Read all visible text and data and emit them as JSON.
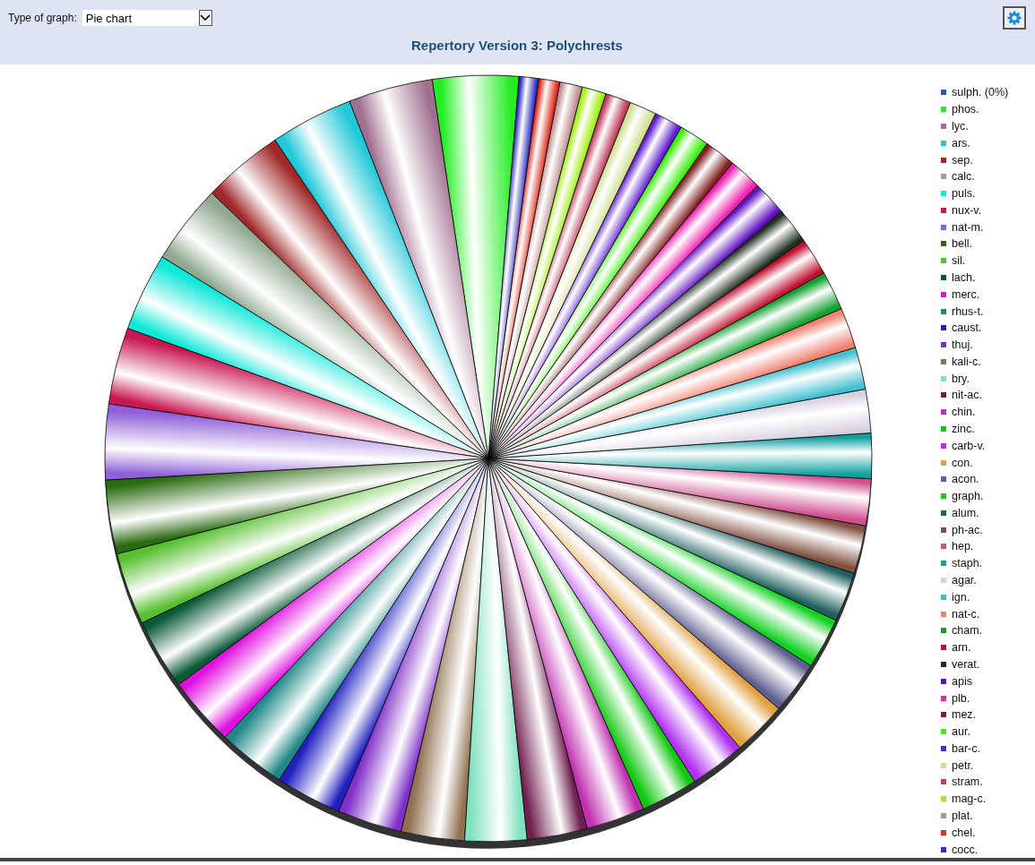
{
  "toolbar": {
    "graph_type_label": "Type of graph:",
    "graph_type": {
      "value": "Pie chart"
    }
  },
  "title": "Repertory Version 3: Polychrests",
  "legend": [
    {
      "label": "sulph. (0%)",
      "color": "#2d5a9a"
    },
    {
      "label": "phos.",
      "color": "#22ee22"
    },
    {
      "label": "lyc.",
      "color": "#a07090"
    },
    {
      "label": "ars.",
      "color": "#20c8d8"
    },
    {
      "label": "sep.",
      "color": "#a02828"
    },
    {
      "label": "calc.",
      "color": "#90a890"
    },
    {
      "label": "puls.",
      "color": "#10e8d8"
    },
    {
      "label": "nux-v.",
      "color": "#c81850"
    },
    {
      "label": "nat-m.",
      "color": "#9060d8"
    },
    {
      "label": "bell.",
      "color": "#2a6a10"
    },
    {
      "label": "sil.",
      "color": "#58c030"
    },
    {
      "label": "lach.",
      "color": "#0a5a38"
    },
    {
      "label": "merc.",
      "color": "#e010e0"
    },
    {
      "label": "rhus-t.",
      "color": "#208888"
    },
    {
      "label": "caust.",
      "color": "#2020c0"
    },
    {
      "label": "thuj.",
      "color": "#8030c8"
    },
    {
      "label": "kali-c.",
      "color": "#907050"
    },
    {
      "label": "bry.",
      "color": "#80e0c0"
    },
    {
      "label": "nit-ac.",
      "color": "#702050"
    },
    {
      "label": "chin.",
      "color": "#c030b0"
    },
    {
      "label": "zinc.",
      "color": "#10c810"
    },
    {
      "label": "carb-v.",
      "color": "#b030f0"
    },
    {
      "label": "con.",
      "color": "#e0a040"
    },
    {
      "label": "acon.",
      "color": "#606090"
    },
    {
      "label": "graph.",
      "color": "#10d020"
    },
    {
      "label": "alum.",
      "color": "#206060"
    },
    {
      "label": "ph-ac.",
      "color": "#805040"
    },
    {
      "label": "hep.",
      "color": "#d05090"
    },
    {
      "label": "staph.",
      "color": "#10a0a0"
    },
    {
      "label": "agar.",
      "color": "#d8d0e0"
    },
    {
      "label": "ign.",
      "color": "#40c0d0"
    },
    {
      "label": "nat-c.",
      "color": "#f08070"
    },
    {
      "label": "cham.",
      "color": "#10a030"
    },
    {
      "label": "arn.",
      "color": "#c01030"
    },
    {
      "label": "verat.",
      "color": "#203020"
    },
    {
      "label": "apis",
      "color": "#6010c0"
    },
    {
      "label": "plb.",
      "color": "#f020b0"
    },
    {
      "label": "mez.",
      "color": "#802020"
    },
    {
      "label": "aur.",
      "color": "#40f010"
    },
    {
      "label": "bar-c.",
      "color": "#6020d0"
    },
    {
      "label": "petr.",
      "color": "#d0e090"
    },
    {
      "label": "stram.",
      "color": "#c04060"
    },
    {
      "label": "mag-c.",
      "color": "#a0f010"
    },
    {
      "label": "plat.",
      "color": "#c09090"
    },
    {
      "label": "chel.",
      "color": "#e03020"
    },
    {
      "label": "cocc.",
      "color": "#3030c0"
    }
  ]
}
